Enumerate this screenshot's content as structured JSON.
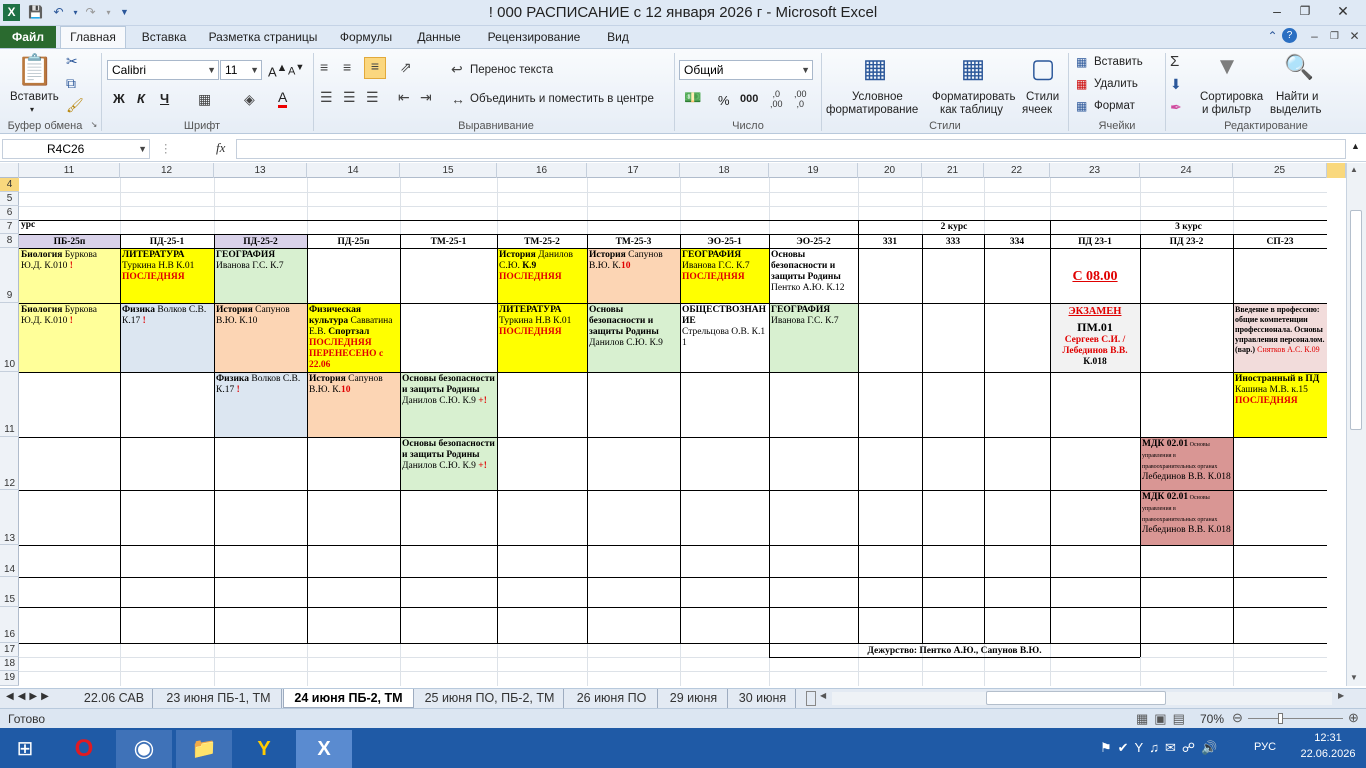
{
  "window": {
    "title": "! 000 РАСПИСАНИЕ с 12 января 2026 г  -  Microsoft Excel"
  },
  "tabs": [
    "Файл",
    "Главная",
    "Вставка",
    "Разметка страницы",
    "Формулы",
    "Данные",
    "Рецензирование",
    "Вид"
  ],
  "ribbon": {
    "paste": "Вставить",
    "clipboard": "Буфер обмена",
    "font_name": "Calibri",
    "font_size": "11",
    "font_group": "Шрифт",
    "bold": "Ж",
    "italic": "К",
    "underline": "Ч",
    "wrap_text": "Перенос текста",
    "merge": "Объединить и поместить в центре",
    "align_group": "Выравнивание",
    "number_format": "Общий",
    "number_group": "Число",
    "percent": "%",
    "thousands": "000",
    "cond_format": [
      "Условное",
      "форматирование"
    ],
    "format_table": [
      "Форматировать",
      "как таблицу"
    ],
    "cell_styles": [
      "Стили",
      "ячеек"
    ],
    "styles_group": "Стили",
    "insert": "Вставить",
    "delete": "Удалить",
    "format": "Формат",
    "cells_group": "Ячейки",
    "sort": [
      "Сортировка",
      "и фильтр"
    ],
    "find": [
      "Найти и",
      "выделить"
    ],
    "editing_group": "Редактирование"
  },
  "formula_bar": {
    "name_box": "R4C26",
    "fx": "fx",
    "value": ""
  },
  "columns": [
    "11",
    "12",
    "13",
    "14",
    "15",
    "16",
    "17",
    "18",
    "19",
    "20",
    "21",
    "22",
    "23",
    "24",
    "25"
  ],
  "rows": [
    "4",
    "5",
    "6",
    "7",
    "8",
    "9",
    "10",
    "11",
    "12",
    "13",
    "14",
    "15",
    "16",
    "17",
    "18",
    "19"
  ],
  "sheet": {
    "course_left": "урс",
    "course2": "2 курс",
    "course3": "3 курс",
    "groups": [
      "ПБ-25п",
      "ПД-25-1",
      "ПД-25-2",
      "ПД-25п",
      "ТМ-25-1",
      "ТМ-25-2",
      "ТМ-25-3",
      "ЭО-25-1",
      "ЭО-25-2",
      "331",
      "333",
      "334",
      "ПД 23-1",
      "ПД 23-2",
      "СП-23"
    ],
    "c9_11_a": "Биология",
    "c9_11_b": " Буркова Ю.Д. К.010 ",
    "c9_11_c": "!",
    "c9_12_a": "ЛИТЕРАТУРА",
    "c9_12_b": "Туркина Н.В К.01",
    "c9_12_c": "ПОСЛЕДНЯЯ",
    "c9_13_a": "ГЕОГРАФИЯ",
    "c9_13_b": "Иванова Г.С. К.7",
    "c9_16_a": "История",
    "c9_16_b": " Данилов С.Ю. ",
    "c9_16_c": "К.9",
    "c9_16_d": "ПОСЛЕДНЯЯ",
    "c9_17_a": "История",
    "c9_17_b": " Сапунов В.Ю. К.",
    "c9_17_c": "10",
    "c9_18_a": "ГЕОГРАФИЯ",
    "c9_18_b": "Иванова Г.С. К.7",
    "c9_18_c": "ПОСЛЕДНЯЯ",
    "c9_19_a": "Основы безопасности и защиты Родины",
    "c9_19_b": " Пентко А.Ю. К.12",
    "c9_23": "С 08.00",
    "c10_11_a": "Биология",
    "c10_11_b": " Буркова Ю.Д. К.010 ",
    "c10_11_c": "!",
    "c10_12_a": "Физика",
    "c10_12_b": "  Волков С.В. К.17 ",
    "c10_12_c": "!",
    "c10_13_a": "История",
    "c10_13_b": " Сапунов В.Ю. К.10",
    "c10_14_a": "Физическая культура",
    "c10_14_b": " Савватина Е.В. ",
    "c10_14_c": "Спортзал",
    "c10_14_d": "ПОСЛЕДНЯЯ ПЕРЕНЕСЕНО с 22.06",
    "c10_16_a": "ЛИТЕРАТУРА",
    "c10_16_b": "Туркина Н.В К.01",
    "c10_16_c": "ПОСЛЕДНЯЯ",
    "c10_17_a": "Основы безопасности и защиты Родины",
    "c10_17_b": " Данилов С.Ю. К.9",
    "c10_18_a": "ОБЩЕСТВОЗНАНИЕ",
    "c10_18_b": "Стрельцова О.В. К.11",
    "c10_19_a": "ГЕОГРАФИЯ",
    "c10_19_b": "Иванова Г.С. К.7",
    "c10_23_a": "ЭКЗАМЕН",
    "c10_23_b": "ПМ.01",
    "c10_23_c": "Сергеев С.И. /Лебединов В.В.",
    "c10_23_d": "К.018",
    "c10_25_a": "Введение в профессию: общие компетенции профессионала. Основы управления персоналом. (вар.)",
    "c10_25_b": " Снятков А.С. К.09",
    "c11_13_a": "Физика",
    "c11_13_b": "  Волков С.В. К.17 ",
    "c11_13_c": "!",
    "c11_14_a": "История",
    "c11_14_b": " Сапунов В.Ю. К.",
    "c11_14_c": "10",
    "c11_15_a": "Основы безопасности и защиты Родины",
    "c11_15_b": " Данилов С.Ю. К.9 ",
    "c11_15_c": "+!",
    "c11_25_a": "Иностранный в ПД",
    "c11_25_b": " Кашина М.В. к.15",
    "c11_25_c": "ПОСЛЕДНЯЯ",
    "c12_15_a": "Основы безопасности и защиты Родины",
    "c12_15_b": " Данилов С.Ю. К.9 ",
    "c12_15_c": "+!",
    "c12_24_a": "МДК 02.01",
    "c12_24_b": " Основы управления в правоохранительных органах ",
    "c12_24_c": "Лебединов В.В. К.018",
    "c13_24_a": "МДК 02.01",
    "c13_24_b": " Основы управления в правоохранительных органах ",
    "c13_24_c": "Лебединов В.В. К.018",
    "duty": "Дежурство: Пентко А.Ю., Сапунов В.Ю."
  },
  "sheet_tabs": [
    "22.06 САВ",
    "23 июня ПБ-1, ТМ",
    "24 июня ПБ-2, ТМ",
    "25 июня ПО, ПБ-2, ТМ",
    "26 июня ПО",
    "29 июня",
    "30 июня"
  ],
  "status": {
    "ready": "Готово",
    "zoom": "70%"
  },
  "taskbar": {
    "lang": "РУС",
    "time": "12:31",
    "date": "22.06.2026"
  },
  "colors": {
    "yellow": "#ffff00",
    "blue": "#dce6f1",
    "green": "#d8f0d0",
    "peach": "#fcd5b4",
    "rose": "#d99694",
    "header": "#d9d2e9"
  }
}
